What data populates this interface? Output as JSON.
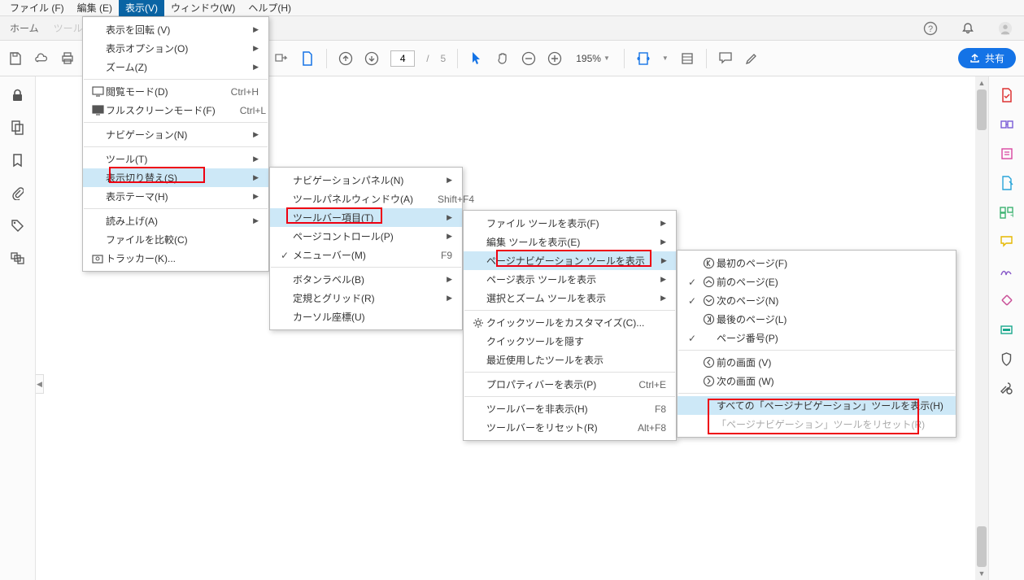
{
  "menubar": {
    "file": "ファイル (F)",
    "edit": "編集 (E)",
    "view": "表示(V)",
    "window": "ウィンドウ(W)",
    "help": "ヘルプ(H)"
  },
  "subnav": {
    "home": "ホーム",
    "tools": "ツール"
  },
  "toolbar": {
    "page_current": "4",
    "page_sep": "/",
    "page_total": "5",
    "zoom": "195%",
    "share": "共有"
  },
  "menu1": {
    "rotate": "表示を回転 (V)",
    "display_opts": "表示オプション(O)",
    "zoom": "ズーム(Z)",
    "read_mode": "閲覧モード(D)",
    "read_mode_key": "Ctrl+H",
    "fullscreen": "フルスクリーンモード(F)",
    "fullscreen_key": "Ctrl+L",
    "navigation": "ナビゲーション(N)",
    "tools": "ツール(T)",
    "toggle": "表示切り替え(S)",
    "theme": "表示テーマ(H)",
    "readaloud": "読み上げ(A)",
    "compare": "ファイルを比較(C)",
    "tracker": "トラッカー(K)..."
  },
  "menu2": {
    "nav_panel": "ナビゲーションパネル(N)",
    "tool_panel": "ツールパネルウィンドウ(A)",
    "tool_panel_key": "Shift+F4",
    "toolbar_items": "ツールバー項目(T)",
    "page_controls": "ページコントロール(P)",
    "menubar": "メニューバー(M)",
    "menubar_key": "F9",
    "button_labels": "ボタンラベル(B)",
    "rulers_grid": "定規とグリッド(R)",
    "cursor_coord": "カーソル座標(U)"
  },
  "menu3": {
    "file_tools": "ファイル ツールを表示(F)",
    "edit_tools": "編集 ツールを表示(E)",
    "page_nav_tools": "ページナビゲーション ツールを表示",
    "page_disp_tools": "ページ表示 ツールを表示",
    "sel_zoom_tools": "選択とズーム ツールを表示",
    "customize_quick": "クイックツールをカスタマイズ(C)...",
    "hide_quick": "クイックツールを隠す",
    "recent_tools": "最近使用したツールを表示",
    "property_bar": "プロパティバーを表示(P)",
    "property_bar_key": "Ctrl+E",
    "hide_toolbar": "ツールバーを非表示(H)",
    "hide_toolbar_key": "F8",
    "reset_toolbar": "ツールバーをリセット(R)",
    "reset_toolbar_key": "Alt+F8"
  },
  "menu4": {
    "first_page": "最初のページ(F)",
    "prev_page": "前のページ(E)",
    "next_page": "次のページ(N)",
    "last_page": "最後のページ(L)",
    "page_number": "ページ番号(P)",
    "prev_view": "前の画面 (V)",
    "next_view": "次の画面 (W)",
    "show_all": "すべての「ページナビゲーション」ツールを表示(H)",
    "reset": "「ページナビゲーション」ツールをリセット(R)"
  }
}
